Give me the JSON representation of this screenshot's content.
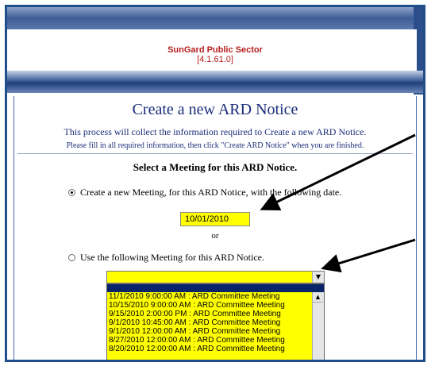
{
  "header": {
    "app_name": "SunGard Public Sector",
    "version": "[4.1.61.0]"
  },
  "page": {
    "title": "Create a new ARD Notice",
    "description": "This process will collect the information required to Create a new ARD Notice.",
    "instructions": "Please fill in all required information, then click \"Create ARD Notice\" when you are finished."
  },
  "form": {
    "section_title": "Select a Meeting for this ARD Notice.",
    "option_new": "Create a new Meeting, for this ARD Notice, with the following date.",
    "date_value": "10/01/2010",
    "or_text": "or",
    "option_existing": "Use the following Meeting for this ARD Notice.",
    "meeting_options": [
      "11/1/2010 9:00:00 AM : ARD Committee Meeting",
      "10/15/2010 9:00:00 AM : ARD Committee Meeting",
      "9/15/2010 2:00:00 PM : ARD Committee Meeting",
      "9/1/2010 10:45:00 AM : ARD Committee Meeting",
      "9/1/2010 12:00:00 AM : ARD Committee Meeting",
      "8/27/2010 12:00:00 AM : ARD Committee Meeting",
      "8/20/2010 12:00:00 AM : ARD Committee Meeting"
    ]
  },
  "colors": {
    "accent_blue": "#1f4e8a",
    "title_text": "#1b2e7a",
    "header_red": "#b71c1c",
    "field_yellow": "#ffff00"
  }
}
